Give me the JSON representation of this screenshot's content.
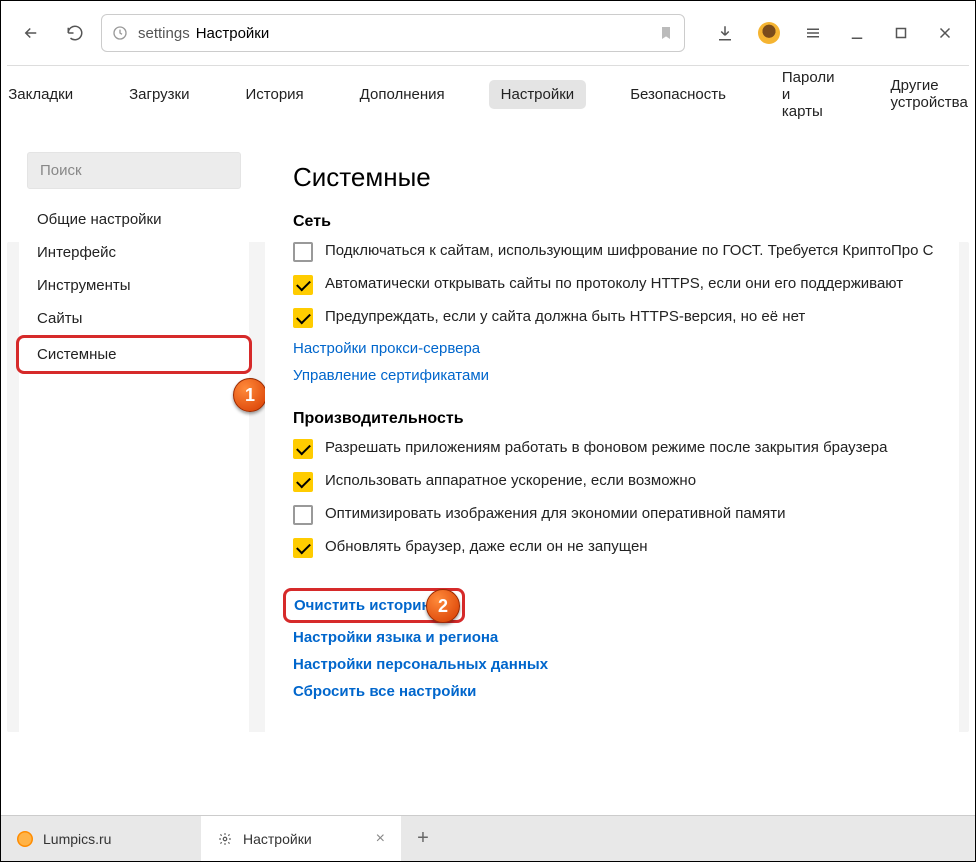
{
  "toolbar": {
    "url_prefix": "settings",
    "url_title": "Настройки"
  },
  "tabs": [
    "Закладки",
    "Загрузки",
    "История",
    "Дополнения",
    "Настройки",
    "Безопасность",
    "Пароли и карты",
    "Другие устройства"
  ],
  "tabs_active_index": 4,
  "sidebar": {
    "search_placeholder": "Поиск",
    "items": [
      "Общие настройки",
      "Интерфейс",
      "Инструменты",
      "Сайты",
      "Системные"
    ],
    "selected_index": 4
  },
  "main": {
    "title": "Системные",
    "sections": [
      {
        "title": "Сеть",
        "rows": [
          {
            "checked": false,
            "label": "Подключаться к сайтам, использующим шифрование по ГОСТ. Требуется КриптоПро C"
          },
          {
            "checked": true,
            "label": "Автоматически открывать сайты по протоколу HTTPS, если они его поддерживают"
          },
          {
            "checked": true,
            "label": "Предупреждать, если у сайта должна быть HTTPS-версия, но её нет"
          }
        ],
        "links": [
          "Настройки прокси-сервера",
          "Управление сертификатами"
        ]
      },
      {
        "title": "Производительность",
        "rows": [
          {
            "checked": true,
            "label": "Разрешать приложениям работать в фоновом режиме после закрытия браузера"
          },
          {
            "checked": true,
            "label": "Использовать аппаратное ускорение, если возможно"
          },
          {
            "checked": false,
            "label": "Оптимизировать изображения для экономии оперативной памяти"
          },
          {
            "checked": true,
            "label": "Обновлять браузер, даже если он не запущен"
          }
        ],
        "links": []
      }
    ],
    "action_links": {
      "clear_history": "Очистить историю",
      "lang_region": "Настройки языка и региона",
      "personal_data": "Настройки персональных данных",
      "reset": "Сбросить все настройки"
    }
  },
  "annotations": {
    "badge1": "1",
    "badge2": "2"
  },
  "bottom_tabs": [
    {
      "label": "Lumpics.ru",
      "active": false
    },
    {
      "label": "Настройки",
      "active": true
    }
  ]
}
